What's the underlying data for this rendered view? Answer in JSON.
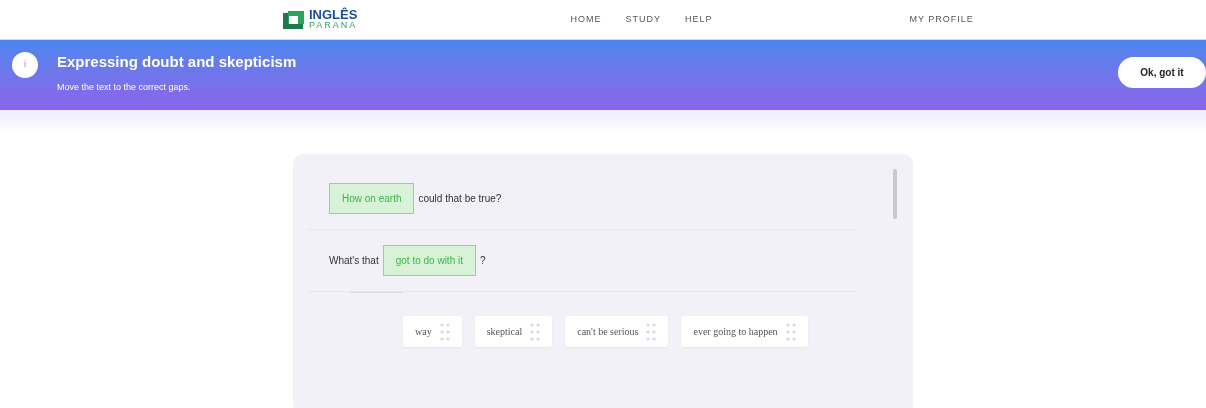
{
  "header": {
    "logo": {
      "line_1": "INGLÊS",
      "line_2": "PARANA"
    },
    "nav": [
      "HOME",
      "STUDY",
      "HELP"
    ],
    "profile": "MY PROFILE"
  },
  "banner": {
    "icon": "i",
    "title": "Expressing doubt and skepticism",
    "subtitle": "Move the text to the correct gaps.",
    "button": "Ok, got it"
  },
  "exercise": {
    "sentences": [
      [
        {
          "kind": "gap",
          "text": "How on earth",
          "correct": true
        },
        {
          "kind": "text",
          "text": "could that be true?"
        }
      ],
      [
        {
          "kind": "text",
          "text": "What's that"
        },
        {
          "kind": "gap",
          "text": "got to do with it",
          "correct": true
        },
        {
          "kind": "text",
          "text": "?"
        }
      ]
    ],
    "word_bank": [
      "way",
      "skeptical",
      "can't be serious",
      "ever going to happen"
    ]
  }
}
